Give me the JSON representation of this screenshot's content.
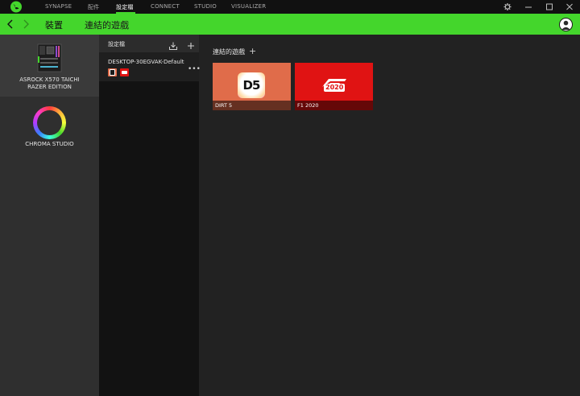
{
  "nav": {
    "items": [
      {
        "label": "SYNAPSE"
      },
      {
        "label": "配件"
      },
      {
        "label": "設定檔",
        "active": true
      },
      {
        "label": "CONNECT"
      },
      {
        "label": "STUDIO"
      },
      {
        "label": "VISUALIZER"
      }
    ]
  },
  "header": {
    "title": "裝置",
    "subtitle": "連結的遊戲"
  },
  "sidebar": {
    "devices": [
      {
        "label_line1": "ASROCK X570 TAICHI",
        "label_line2": "RAZER EDITION",
        "icon": "motherboard-icon",
        "selected": true
      },
      {
        "label_line1": "CHROMA STUDIO",
        "icon": "chroma-ring-icon"
      }
    ]
  },
  "profiles": {
    "title": "設定檔",
    "items": [
      {
        "name": "DESKTOP-30EGVAK-Default",
        "games": [
          "DIRT 5",
          "F1 2020"
        ]
      }
    ]
  },
  "main": {
    "section_title": "連結的遊戲",
    "games": [
      {
        "label": "DIRT 5",
        "logo_text": "D5",
        "color": "#e06c4a"
      },
      {
        "label": "F1 2020",
        "logo_text": "2020",
        "color": "#e01313"
      }
    ]
  },
  "colors": {
    "accent": "#44d62c",
    "titlebar": "#111111",
    "panel": "#222222"
  }
}
